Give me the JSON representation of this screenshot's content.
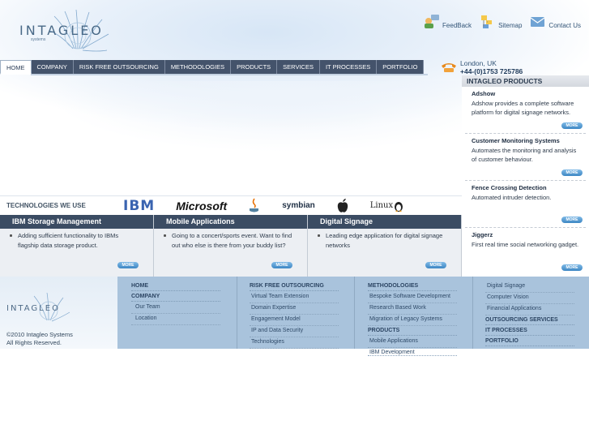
{
  "brand": {
    "name": "INTAGLEO",
    "sub": "systems"
  },
  "toplinks": [
    {
      "label": "FeedBack"
    },
    {
      "label": "Sitemap"
    },
    {
      "label": "Contact Us"
    }
  ],
  "nav": [
    "HOME",
    "COMPANY",
    "RISK FREE OUTSOURCING",
    "METHODOLOGIES",
    "PRODUCTS",
    "SERVICES",
    "IT PROCESSES",
    "PORTFOLIO"
  ],
  "contact": {
    "city": "London, UK",
    "phone": "+44-(0)1753 725786"
  },
  "products": {
    "title": "INTAGLEO PRODUCTS",
    "more": "MORE",
    "items": [
      {
        "name": "Adshow",
        "desc": "Adshow provides a complete software platform for digital signage networks."
      },
      {
        "name": "Customer Monitoring Systems",
        "desc": "Automates the monitoring and analysis of customer behaviour."
      },
      {
        "name": "Fence Crossing Detection",
        "desc": "Automated intruder detection."
      },
      {
        "name": "Jiggerz",
        "desc": "First real time social networking gadget."
      }
    ]
  },
  "tech": {
    "label": "TECHNOLOGIES WE USE",
    "logos": [
      "IBM",
      "Microsoft",
      "Java",
      "symbian",
      "Apple",
      "Linux"
    ]
  },
  "cards": [
    {
      "title": "IBM Storage Management",
      "text": "Adding sufficient functionality to IBMs flagship data storage product."
    },
    {
      "title": "Mobile Applications",
      "text": "Going to a concert/sports event. Want to find out who else is there from your buddy list?"
    },
    {
      "title": "Digital Signage",
      "text": "Leading edge application for digital signage networks"
    }
  ],
  "footer": {
    "copyright": "©2010 Intagleo Systems",
    "rights": "All Rights Reserved.",
    "col1": {
      "items": [
        "HOME",
        "COMPANY"
      ],
      "sub": [
        "Our Team",
        "Location"
      ]
    },
    "col2": {
      "head": "RISK FREE OUTSOURCING",
      "items": [
        "Virtual Team Extension",
        "Domain Expertise",
        "Engagement Model",
        "IP and Data Security",
        "Technologies"
      ]
    },
    "col3": {
      "head": "METHODOLOGIES",
      "items": [
        "Bespoke Software Development",
        "Research Based Work",
        "Migration of Legacy Systems"
      ],
      "head2": "PRODUCTS",
      "items2": [
        "Mobile Applications",
        "IBM Development"
      ]
    },
    "col4": {
      "items": [
        "Digital Signage",
        "Computer Vision",
        "Financial Applications"
      ],
      "heads": [
        "OUTSOURCING SERVICES",
        "IT PROCESSES",
        "PORTFOLIO"
      ]
    }
  }
}
